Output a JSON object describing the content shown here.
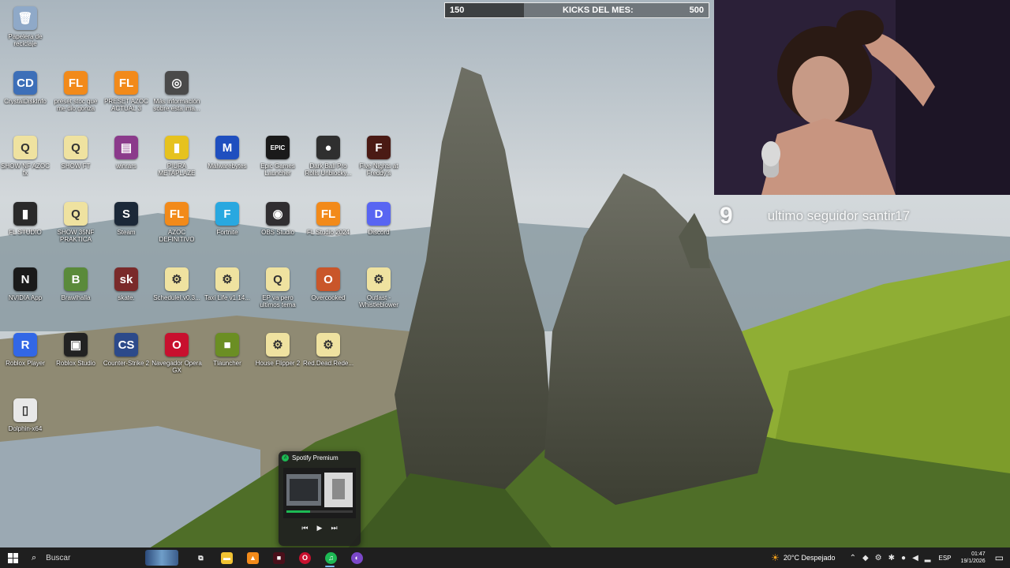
{
  "desktop": {
    "icons": [
      {
        "label": "Papelera de reciclaje",
        "glyph": "🗑",
        "color": "#8fa9c8"
      },
      {
        "label": "CrystalDiskInfo",
        "glyph": "CD",
        "color": "#3d6fb8"
      },
      {
        "label": "preset stoc que me dio gonza",
        "glyph": "FL",
        "color": "#f28a1a"
      },
      {
        "label": "PRESET AZOC ACTUAL 3",
        "glyph": "FL",
        "color": "#f28a1a"
      },
      {
        "label": "Más información sobre esta ima...",
        "glyph": "◎",
        "color": "#4a4a4a"
      },
      {
        "label": "SHOW NF AZOC fx",
        "glyph": "Q",
        "color": "#efe2a0"
      },
      {
        "label": "SHOW FT",
        "glyph": "Q",
        "color": "#efe2a0"
      },
      {
        "label": "winrars",
        "glyph": "▤",
        "color": "#8b3a8b"
      },
      {
        "label": "PIURA METAPLAZE",
        "glyph": "▮",
        "color": "#e6c21f"
      },
      {
        "label": "Malwarebytes",
        "glyph": "M",
        "color": "#1f4fbf"
      },
      {
        "label": "Epic Games Launcher",
        "glyph": "EPIC",
        "color": "#1a1a1a"
      },
      {
        "label": "Dark Ball Pro Rolls Unblocky...",
        "glyph": "●",
        "color": "#2f2f2f"
      },
      {
        "label": "Five Nights at Freddy's",
        "glyph": "F",
        "color": "#4a1a14"
      },
      {
        "label": "FL STUDIO",
        "glyph": "▮",
        "color": "#2a2a2a"
      },
      {
        "label": "SHOW 35NF PRAKTICA",
        "glyph": "Q",
        "color": "#efe2a0"
      },
      {
        "label": "Steam",
        "glyph": "S",
        "color": "#1b2838"
      },
      {
        "label": "AZOC DEFINITIVO",
        "glyph": "FL",
        "color": "#f28a1a"
      },
      {
        "label": "Fortnite",
        "glyph": "F",
        "color": "#29a8e0"
      },
      {
        "label": "OBS Studio",
        "glyph": "◉",
        "color": "#302e31"
      },
      {
        "label": "FL Studio 2024",
        "glyph": "FL",
        "color": "#f28a1a"
      },
      {
        "label": "Discord",
        "glyph": "D",
        "color": "#5865f2"
      },
      {
        "label": "NVIDIA App",
        "glyph": "N",
        "color": "#1a1a1a"
      },
      {
        "label": "Brawlhalla",
        "glyph": "B",
        "color": "#5a8a3a"
      },
      {
        "label": "skate.",
        "glyph": "sk",
        "color": "#7a2a2a"
      },
      {
        "label": "ScheduleI.v0.3...",
        "glyph": "⚙",
        "color": "#efe2a0"
      },
      {
        "label": "Taxi Life v1.14...",
        "glyph": "⚙",
        "color": "#efe2a0"
      },
      {
        "label": "EP va pero ultimos tema",
        "glyph": "Q",
        "color": "#efe2a0"
      },
      {
        "label": "Overcooked",
        "glyph": "O",
        "color": "#c9562a"
      },
      {
        "label": "Outlast - Whistleblower",
        "glyph": "⚙",
        "color": "#efe2a0"
      },
      {
        "label": "Roblox Player",
        "glyph": "R",
        "color": "#3267e6"
      },
      {
        "label": "Roblox Studio",
        "glyph": "▣",
        "color": "#222222"
      },
      {
        "label": "Counter-Strike 2",
        "glyph": "CS",
        "color": "#2c4a8a"
      },
      {
        "label": "Navegador Opera GX",
        "glyph": "O",
        "color": "#c8102e"
      },
      {
        "label": "Tlauncher",
        "glyph": "■",
        "color": "#6b8e23"
      },
      {
        "label": "House Flipper 2",
        "glyph": "⚙",
        "color": "#efe2a0"
      },
      {
        "label": "Red.Dead.Rede...",
        "glyph": "⚙",
        "color": "#efe2a0"
      },
      {
        "label": "Dolphin-x64",
        "glyph": "▯",
        "color": "#e8e8e8"
      }
    ]
  },
  "overlay": {
    "kicks_current": "150",
    "kicks_title": "KICKS DEL MES:",
    "kicks_max": "500",
    "kicks_progress": 0.3,
    "follower_count": "9",
    "follower_text": "ultimo seguidor  santir17"
  },
  "spotify_preview": {
    "title": "Spotify Premium",
    "controls": [
      "⏮",
      "▶",
      "⏭"
    ]
  },
  "taskbar": {
    "search_placeholder": "Buscar",
    "apps": [
      {
        "name": "task-view",
        "glyph": "⧉",
        "color": "transparent"
      },
      {
        "name": "file-explorer",
        "glyph": "▬",
        "color": "#f1c232"
      },
      {
        "name": "fl-studio",
        "glyph": "▲",
        "color": "#f28a1a"
      },
      {
        "name": "app-dark",
        "glyph": "■",
        "color": "#4a0f1a"
      },
      {
        "name": "opera-gx",
        "glyph": "O",
        "color": "#c8102e"
      },
      {
        "name": "spotify",
        "glyph": "♫",
        "color": "#1db954"
      },
      {
        "name": "discord-purple",
        "glyph": "◐",
        "color": "#7b48c9"
      }
    ],
    "weather": {
      "icon": "☀",
      "text": "20°C Despejado"
    },
    "language": "ESP",
    "time": "01:47",
    "date": "19/1/2026"
  }
}
